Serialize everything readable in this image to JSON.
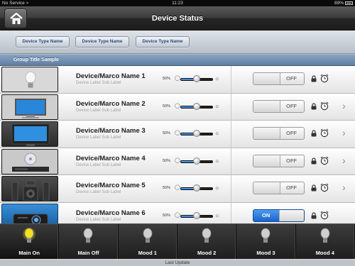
{
  "status_bar": {
    "carrier": "No Service",
    "time": "11:23",
    "battery": "89%"
  },
  "nav": {
    "title": "Device Status"
  },
  "type_filters": [
    "Device Type Name",
    "Device Type Name",
    "Device Type Name"
  ],
  "group": {
    "title": "Group Title Sample"
  },
  "devices": [
    {
      "name": "Device/Marco Name 1",
      "sub_label": "Device Label Sub Label",
      "dim_label": "50%",
      "level": 0.5,
      "state": "OFF",
      "icon": "light-bulb-icon",
      "has_chevron": false
    },
    {
      "name": "Device/Marco Name 2",
      "sub_label": "Device Label Sub Label",
      "dim_label": "50%",
      "level": 0.5,
      "state": "OFF",
      "icon": "monitor-icon",
      "has_chevron": true
    },
    {
      "name": "Device/Marco Name 3",
      "sub_label": "Device Label Sub Label",
      "dim_label": "50%",
      "level": 0.5,
      "state": "OFF",
      "icon": "tv-icon",
      "has_chevron": true
    },
    {
      "name": "Device/Marco Name 4",
      "sub_label": "Device Label Sub Label",
      "dim_label": "50%",
      "level": 0.5,
      "state": "OFF",
      "icon": "dvd-player-icon",
      "has_chevron": true
    },
    {
      "name": "Device/Marco Name 5",
      "sub_label": "Device Label Sub Label",
      "dim_label": "50%",
      "level": 0.5,
      "state": "OFF",
      "icon": "speaker-system-icon",
      "has_chevron": true
    },
    {
      "name": "Device/Marco Name 6",
      "sub_label": "Device Label Sub Label",
      "dim_label": "50%",
      "level": 0.5,
      "state": "ON",
      "icon": "projector-icon",
      "has_chevron": false
    }
  ],
  "moods": [
    {
      "label": "Main On",
      "active": true
    },
    {
      "label": "Main Off",
      "active": false
    },
    {
      "label": "Mood 1",
      "active": false
    },
    {
      "label": "Mood 2",
      "active": false
    },
    {
      "label": "Mood 3",
      "active": false
    },
    {
      "label": "Mood 4",
      "active": false
    }
  ],
  "footer": {
    "text": "Last Update"
  },
  "colors": {
    "accent": "#1c67cf",
    "group_bar": "#6f8db0",
    "on_bulb": "#f4e21a"
  }
}
